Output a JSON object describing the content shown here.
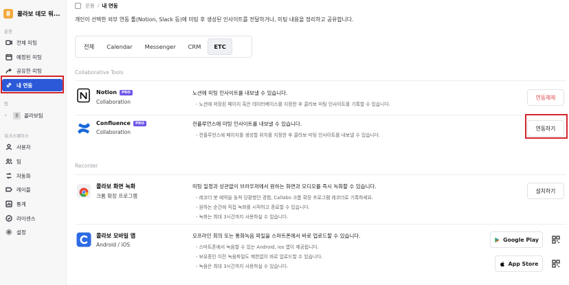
{
  "workspace": {
    "logo_text": "콜",
    "name": "콜라보 데모 워..."
  },
  "sidebar": {
    "section_meeting": "운용",
    "items": [
      {
        "label": "전체 미팅",
        "icon": "video-icon"
      },
      {
        "label": "예정된 미팅",
        "icon": "calendar-icon"
      },
      {
        "label": "공유한 미팅",
        "icon": "share-icon"
      },
      {
        "label": "내 연동",
        "icon": "link-icon"
      }
    ],
    "section_team": "팀",
    "team": {
      "logo_text": "콜",
      "label": "콜라보팀"
    },
    "section_workspace": "워크스페이스",
    "ws_items": [
      {
        "label": "사용자",
        "icon": "user-icon"
      },
      {
        "label": "팀",
        "icon": "team-icon"
      },
      {
        "label": "자동화",
        "icon": "automation-icon"
      },
      {
        "label": "레이블",
        "icon": "label-icon"
      },
      {
        "label": "통계",
        "icon": "stats-icon"
      },
      {
        "label": "라이센스",
        "icon": "license-icon"
      },
      {
        "label": "설정",
        "icon": "gear-icon"
      }
    ]
  },
  "breadcrumb": {
    "parent": "운용",
    "separator": "/",
    "current": "내 연동"
  },
  "description": "개인이 선택한 외부 연동 툴(Notion, Slack 등)에 미팅 후 생성된 인사이트를 전달하거나, 미팅 내용을 정리하고 공유합니다.",
  "tabs": [
    "전체",
    "Calendar",
    "Messenger",
    "CRM",
    "ETC"
  ],
  "active_tab": "ETC",
  "collab": {
    "title": "Collaborative Tools",
    "notion": {
      "name": "Notion",
      "badge": "PRO",
      "sub": "Collaboration",
      "desc": "노션에 미팅 인사이트를 내보낼 수 있습니다.",
      "bullet": "노션에 저장된 페이지 혹은 데이터베이스를 지정한 후 콜라보 미팅 인사이트를 기록할 수 있습니다.",
      "button": "연동해제"
    },
    "confluence": {
      "name": "Confluence",
      "badge": "PRO",
      "sub": "Collaboration",
      "desc": "컨플루언스에 미팅 인사이트를 내보낼 수 있습니다.",
      "bullet": "컨플루언스에 페이지를 생성할 위치를 지정한 후 콜라보 미팅 인사이트를 내보낼 수 있습니다.",
      "button": "연동하기"
    }
  },
  "recorder": {
    "title": "Recorder",
    "chrome": {
      "name": "콜라보 화면 녹화",
      "sub": "크롬 확장 프로그램",
      "desc": "미팅 일정과 상관없이 브라우저에서 원하는 화면과 오디오를 즉시 녹화할 수 있습니다.",
      "bullets": [
        "레코더 봇 예약을 놓쳐 당황했던 경험, Callabo 크롬 확장 프로그램 레코더로 기록하세요.",
        "원하는 순간에 직접 녹화를 시작하고 종료할 수 있습니다.",
        "녹화는 최대 3시간까지 사용하실 수 있습니다."
      ],
      "button": "설치하기"
    },
    "mobile": {
      "name": "콜라보 모바일 앱",
      "sub": "Android / iOS",
      "desc": "오프라인 회의 또는 통화녹음 파일을 스마트폰에서 바로 업로드할 수 있습니다.",
      "bullets": [
        "스마트폰에서 녹음할 수 있는 Android, ios 앱이 제공됩니다.",
        "보유중인 이전 녹음파일도 제한없이 바로 업로드할 수 있습니다.",
        "녹음은 최대 3시간까지 사용하실 수 있습니다."
      ],
      "google_play": "Google Play",
      "app_store": "App Store"
    }
  },
  "colors": {
    "accent": "#2b59d8",
    "pro_badge": "#6d56e8",
    "danger": "#e2454a",
    "highlight": "#d3242a"
  }
}
